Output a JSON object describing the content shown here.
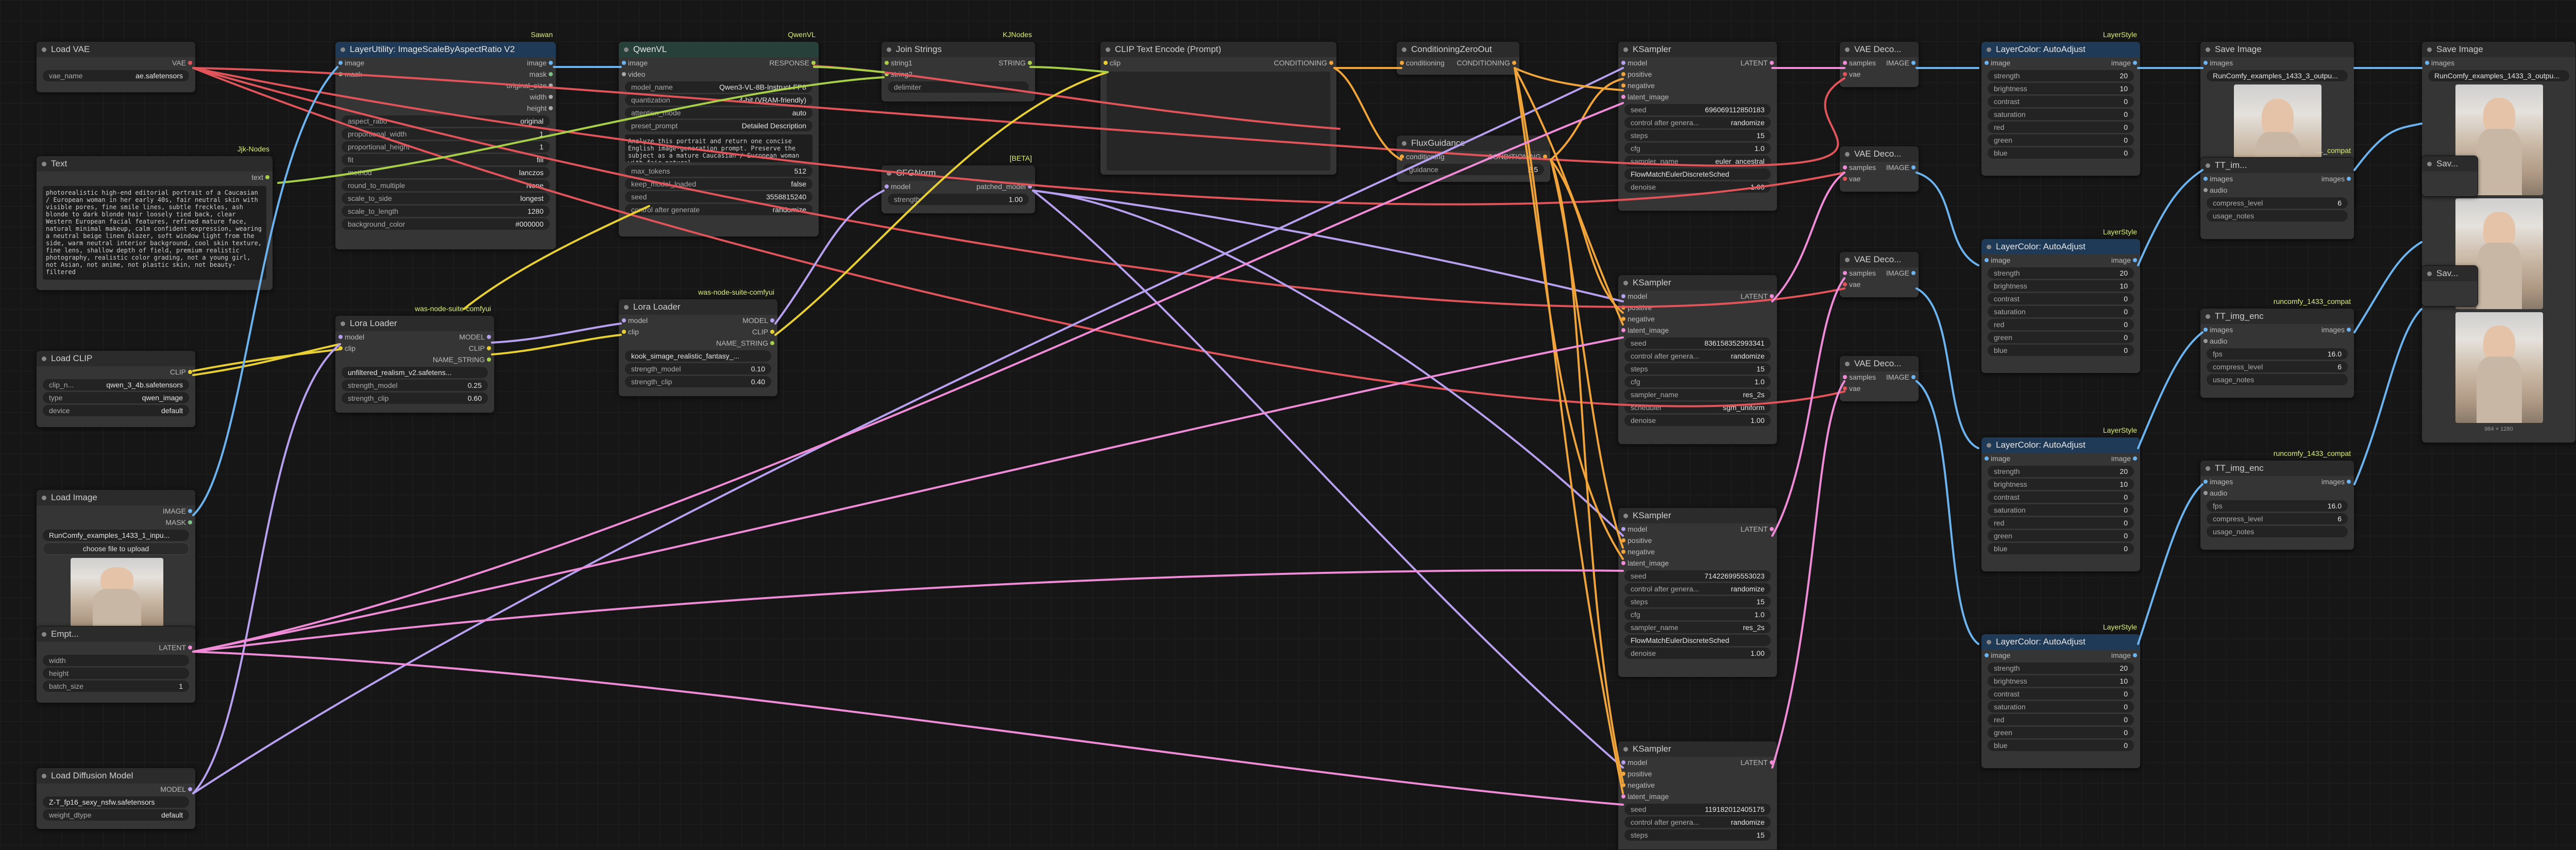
{
  "nodes": {
    "load_vae": {
      "title": "Load VAE",
      "out": "VAE",
      "vae_name_label": "vae_name",
      "vae_name": "ae.safetensors"
    },
    "text": {
      "title": "Text",
      "tag": "Jjk-Nodes",
      "out": "text",
      "body": "photorealistic high-end editorial portrait of a Caucasian / European woman in her early 40s, fair neutral skin with visible pores, fine smile lines, subtle freckles, ash blonde to dark blonde hair loosely tied back, clear Western European facial features, refined mature face, natural minimal makeup, calm confident expression, wearing a neutral beige linen blazer, soft window light from the side, warm neutral interior background, cool skin texture, fine lens, shallow depth of field, premium realistic photography, realistic color grading, not a young girl, not Asian, not anime, not plastic skin, not beauty-filtered"
    },
    "load_clip": {
      "title": "Load CLIP",
      "out": "CLIP",
      "w1k": "clip_n...",
      "w1v": "qwen_3_4b.safetensors",
      "w2k": "type",
      "w2v": "qwen_image",
      "w3k": "device",
      "w3v": "default"
    },
    "load_image": {
      "title": "Load Image",
      "out1": "IMAGE",
      "out2": "MASK",
      "file": "RunComfy_examples_1433_1_inpu...",
      "upload": "choose file to upload"
    },
    "empty": {
      "title": "Empt...",
      "out": "LATENT",
      "k1": "width",
      "k2": "height",
      "k3": "batch_size",
      "v3": "1"
    },
    "load_diffusion": {
      "title": "Load Diffusion Model",
      "out": "MODEL",
      "unet": "Z-T_fp16_sexy_nsfw.safetensors",
      "wdk": "weight_dtype",
      "wdv": "default"
    },
    "layer_utility": {
      "title": "LayerUtility: ImageScaleByAspectRatio V2",
      "tag": "Sawan",
      "in1": "image",
      "in2": "mask",
      "out1": "image",
      "out2": "mask",
      "out3": "original_size",
      "out4": "width",
      "out5": "height",
      "widgets": [
        [
          "aspect_ratio",
          "original"
        ],
        [
          "proportional_width",
          "1"
        ],
        [
          "proportional_height",
          "1"
        ],
        [
          "fit",
          "fill"
        ],
        [
          "method",
          "lanczos"
        ],
        [
          "round_to_multiple",
          "None"
        ],
        [
          "scale_to_side",
          "longest"
        ],
        [
          "scale_to_length",
          "1280"
        ],
        [
          "background_color",
          "#000000"
        ]
      ]
    },
    "qwenvl": {
      "title": "QwenVL",
      "tag": "QwenVL",
      "in1": "image",
      "in2": "video",
      "out": "RESPONSE",
      "widgets": [
        [
          "model_name",
          "Qwen3-VL-8B-Instruct-FP8"
        ],
        [
          "quantization",
          "4-bit (VRAM-friendly)"
        ],
        [
          "attention_mode",
          "auto"
        ],
        [
          "preset_prompt",
          "Detailed Description"
        ]
      ],
      "prompt": "Analyze this portrait and return one concise English image-generation prompt. Preserve the subject as a mature Caucasian / European woman with fair natural",
      "widgets2": [
        [
          "max_tokens",
          "512"
        ],
        [
          "keep_model_loaded",
          "false"
        ],
        [
          "seed",
          "3558815240"
        ],
        [
          "control after generate",
          "randomize"
        ]
      ]
    },
    "join_strings": {
      "title": "Join Strings",
      "tag": "KJNodes",
      "in1": "string1",
      "in2": "string2",
      "out": "STRING",
      "delim": "delimiter"
    },
    "cfgnorm": {
      "title": "CFGNorm",
      "tag": "[BETA]",
      "in": "model",
      "out": "patched_model",
      "wk": "strength",
      "wv": "1.00"
    },
    "clip_text": {
      "title": "CLIP Text Encode (Prompt)",
      "in": "clip",
      "out": "CONDITIONING"
    },
    "cond_zero": {
      "title": "ConditioningZeroOut",
      "in": "conditioning",
      "out": "CONDITIONING"
    },
    "flux_guidance": {
      "title": "FluxGuidance",
      "in": "conditioning",
      "out": "CONDITIONING",
      "wk": "guidance",
      "wv": "2.5"
    },
    "lora1": {
      "title": "Lora Loader",
      "tag": "was-node-suite-comfyui",
      "in1": "model",
      "in2": "clip",
      "out1": "MODEL",
      "out2": "CLIP",
      "out3": "NAME_STRING",
      "widgets": [
        [
          "lora_name",
          "unfiltered_realism_v2.safetens..."
        ],
        [
          "strength_model",
          "0.25"
        ],
        [
          "strength_clip",
          "0.60"
        ]
      ]
    },
    "lora2": {
      "title": "Lora Loader",
      "tag": "was-node-suite-comfyui",
      "in1": "model",
      "in2": "clip",
      "out1": "MODEL",
      "out2": "CLIP",
      "out3": "NAME_STRING",
      "widgets": [
        [
          "lora_name",
          "kook_simage_realistic_fantasy_..."
        ],
        [
          "strength_model",
          "0.10"
        ],
        [
          "strength_clip",
          "0.40"
        ]
      ]
    },
    "ksampler1": {
      "title": "KSampler",
      "widgets": [
        [
          "seed",
          "696069112850183"
        ],
        [
          "control after genera...",
          "randomize"
        ],
        [
          "steps",
          "15"
        ],
        [
          "cfg",
          "1.0"
        ],
        [
          "sampler_name",
          "euler_ancestral"
        ],
        [
          "scheduler",
          "FlowMatchEulerDiscreteSched"
        ],
        [
          "denoise",
          "1.00"
        ]
      ]
    },
    "ksampler2": {
      "title": "KSampler",
      "widgets": [
        [
          "seed",
          "836158352993341"
        ],
        [
          "control after genera...",
          "randomize"
        ],
        [
          "steps",
          "15"
        ],
        [
          "cfg",
          "1.0"
        ],
        [
          "sampler_name",
          "res_2s"
        ],
        [
          "scheduler",
          "sgm_uniform"
        ],
        [
          "denoise",
          "1.00"
        ]
      ]
    },
    "ksampler3": {
      "title": "KSampler",
      "widgets": [
        [
          "seed",
          "714226995553023"
        ],
        [
          "control after genera...",
          "randomize"
        ],
        [
          "steps",
          "15"
        ],
        [
          "cfg",
          "1.0"
        ],
        [
          "sampler_name",
          "res_2s"
        ],
        [
          "scheduler",
          "FlowMatchEulerDiscreteSched"
        ],
        [
          "denoise",
          "1.00"
        ]
      ]
    },
    "ksampler4": {
      "title": "KSampler",
      "widgets": [
        [
          "seed",
          "119182012405175"
        ],
        [
          "control after genera...",
          "randomize"
        ],
        [
          "steps",
          "15"
        ]
      ]
    },
    "ks_io": {
      "in1": "model",
      "in2": "positive",
      "in3": "negative",
      "in4": "latent_image",
      "out": "LATENT"
    },
    "vae_decode": {
      "title": "VAE Deco...",
      "in1": "samples",
      "in2": "vae",
      "out": "IMAGE"
    },
    "layercolor": {
      "title": "LayerColor: AutoAdjust",
      "tag": "LayerStyle",
      "in": "image",
      "out": "image",
      "widgets": [
        [
          "strength",
          "20"
        ],
        [
          "brightness",
          "10"
        ],
        [
          "contrast",
          "0"
        ],
        [
          "saturation",
          "0"
        ],
        [
          "red",
          "0"
        ],
        [
          "green",
          "0"
        ],
        [
          "blue",
          "0"
        ]
      ]
    },
    "save1": {
      "title": "Save Image",
      "in": "images",
      "file": "RunComfy_examples_1433_3_outpu..."
    },
    "save2": {
      "title": "Save Image",
      "in": "images",
      "file": "RunComfy_examples_1433_3_outpu...",
      "caption": "984 × 1280"
    },
    "save_small_title": "Sav...",
    "tt_img": {
      "title": "TT_img_enc",
      "tag": "runcomfy_1433_compat",
      "in1": "images",
      "in2": "audio",
      "out": "images",
      "w": [
        [
          "fps",
          "16.0"
        ],
        [
          "compress_level",
          "6"
        ],
        [
          "usage_notes",
          ""
        ]
      ]
    },
    "tt_img_top": {
      "title": "TT_im...",
      "tag": "..._compat",
      "in": "images",
      "audio": "audio",
      "out": "images",
      "compress": "compress_level",
      "compress_v": "6",
      "usage": "usage_notes"
    }
  }
}
